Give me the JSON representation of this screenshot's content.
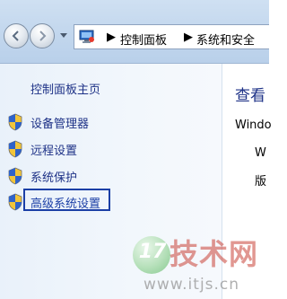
{
  "window": {
    "breadcrumbs": [
      {
        "label": "控制面板"
      },
      {
        "label": "系统和安全"
      }
    ],
    "breadcrumb_separator": "▶"
  },
  "sidebar": {
    "home_link": "控制面板主页",
    "items": [
      {
        "label": "设备管理器",
        "icon": "uac-shield-icon"
      },
      {
        "label": "远程设置",
        "icon": "uac-shield-icon"
      },
      {
        "label": "系统保护",
        "icon": "uac-shield-icon"
      },
      {
        "label": "高级系统设置",
        "icon": "uac-shield-icon",
        "highlighted": true
      }
    ]
  },
  "main": {
    "title": "查看",
    "lines": [
      "Windo",
      "W",
      "版"
    ]
  },
  "watermark": {
    "badge_number": "17",
    "brand": "技术网",
    "url": "www.itjs.cn"
  },
  "colors": {
    "link": "#1e3287",
    "highlight_border": "#1b3fa6",
    "nav_gradient_top": "#cfe0f2",
    "sidebar_bg": "#e9f1fa"
  }
}
